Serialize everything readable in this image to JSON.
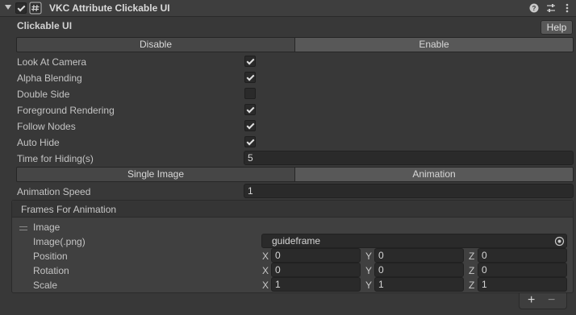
{
  "header": {
    "title": "VKC Attribute Clickable UI",
    "enabled": true
  },
  "section_title": "Clickable UI",
  "help_label": "Help",
  "state_toggle": {
    "left": "Disable",
    "right": "Enable",
    "selected": "Enable"
  },
  "options": [
    {
      "label": "Look At Camera",
      "checked": true
    },
    {
      "label": "Alpha Blending",
      "checked": true
    },
    {
      "label": "Double Side",
      "checked": false
    },
    {
      "label": "Foreground Rendering",
      "checked": true
    },
    {
      "label": "Follow Nodes",
      "checked": true
    },
    {
      "label": "Auto Hide",
      "checked": true
    }
  ],
  "time_for_hiding": {
    "label": "Time for Hiding(s)",
    "value": "5"
  },
  "mode_toggle": {
    "left": "Single Image",
    "right": "Animation",
    "selected": "Animation"
  },
  "animation_speed": {
    "label": "Animation Speed",
    "value": "1"
  },
  "frames": {
    "title": "Frames For Animation",
    "item_title": "Image",
    "image_label": "Image(.png)",
    "image_value": "guideframe",
    "position": {
      "label": "Position",
      "x": "0",
      "y": "0",
      "z": "0"
    },
    "rotation": {
      "label": "Rotation",
      "x": "0",
      "y": "0",
      "z": "0"
    },
    "scale": {
      "label": "Scale",
      "x": "1",
      "y": "1",
      "z": "1"
    },
    "axis_labels": {
      "x": "X",
      "y": "Y",
      "z": "Z"
    }
  },
  "list_controls": {
    "add": "+",
    "remove": "−"
  },
  "colors": {
    "background": "#383838",
    "field": "#2a2a2a",
    "active_toggle": "#585858"
  }
}
